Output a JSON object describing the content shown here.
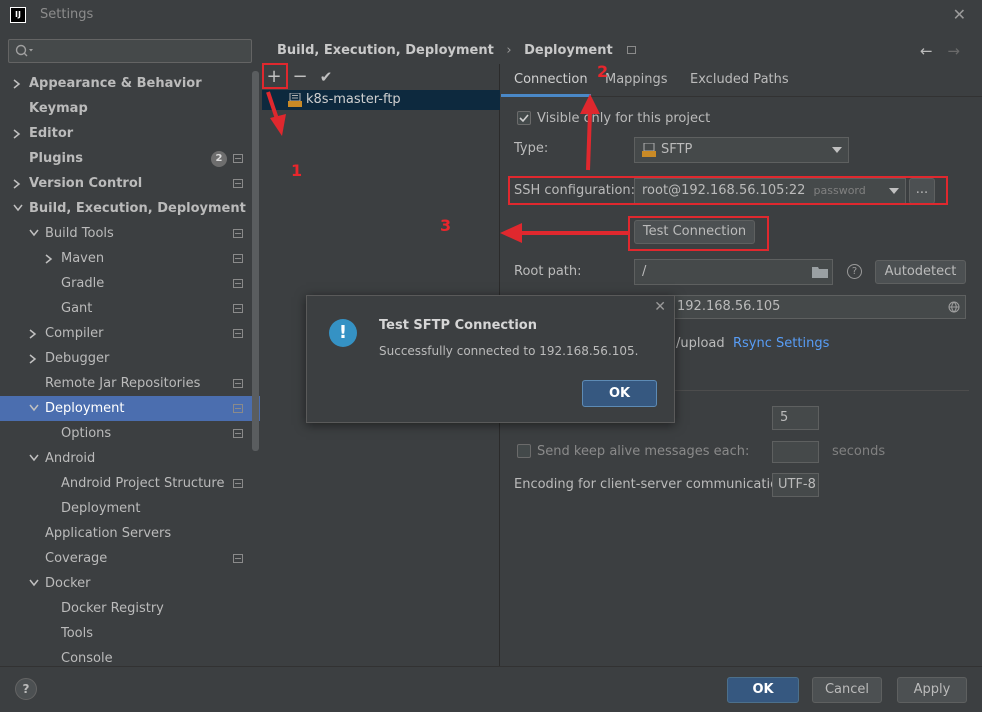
{
  "window": {
    "title": "Settings",
    "app_icon": "IJ"
  },
  "search": {
    "placeholder": ""
  },
  "tree": [
    {
      "label": "Appearance & Behavior",
      "bold": true,
      "arrow": "right"
    },
    {
      "label": "Keymap",
      "bold": true
    },
    {
      "label": "Editor",
      "bold": true,
      "arrow": "right"
    },
    {
      "label": "Plugins",
      "bold": true,
      "badge": "2"
    },
    {
      "label": "Version Control",
      "bold": true,
      "arrow": "right"
    },
    {
      "label": "Build, Execution, Deployment",
      "bold": true,
      "arrow": "down"
    },
    {
      "label": "Build Tools",
      "arrow": "down"
    },
    {
      "label": "Maven",
      "arrow": "right"
    },
    {
      "label": "Gradle"
    },
    {
      "label": "Gant"
    },
    {
      "label": "Compiler",
      "arrow": "right"
    },
    {
      "label": "Debugger",
      "arrow": "right"
    },
    {
      "label": "Remote Jar Repositories"
    },
    {
      "label": "Deployment",
      "arrow": "down",
      "selected": true
    },
    {
      "label": "Options"
    },
    {
      "label": "Android",
      "arrow": "down"
    },
    {
      "label": "Android Project Structure"
    },
    {
      "label": "Deployment"
    },
    {
      "label": "Application Servers"
    },
    {
      "label": "Coverage"
    },
    {
      "label": "Docker",
      "arrow": "down"
    },
    {
      "label": "Docker Registry"
    },
    {
      "label": "Tools"
    },
    {
      "label": "Console"
    }
  ],
  "breadcrumb": {
    "parent": "Build, Execution, Deployment",
    "sep": "›",
    "current": "Deployment"
  },
  "nav": {
    "back": "←",
    "forward": "→"
  },
  "toolbar": {
    "add": "+",
    "remove": "−",
    "apply": "✔"
  },
  "servers": [
    {
      "label": "k8s-master-ftp",
      "icon_text": "SFTP"
    }
  ],
  "tabs": [
    {
      "label": "Connection"
    },
    {
      "label": "Mappings"
    },
    {
      "label": "Excluded Paths"
    }
  ],
  "form": {
    "visible_only_label": "Visible only for this project",
    "type_label": "Type:",
    "type_value": "SFTP",
    "ssh_label": "SSH configuration:",
    "ssh_value": "root@192.168.56.105:22",
    "ssh_hint": "password",
    "ssh_more": "...",
    "test_connection": "Test Connection",
    "root_path_label": "Root path:",
    "root_path_value": "/",
    "help": "?",
    "autodetect": "Autodetect",
    "web_url_value": "192.168.56.105",
    "upload_partial": "/upload",
    "rsync_link": "Rsync Settings",
    "timeout_value": "5",
    "keepalive_label": "Send keep alive messages each:",
    "keepalive_value": "",
    "keepalive_unit": "seconds",
    "encoding_label": "Encoding for client-server communication:",
    "encoding_value": "UTF-8"
  },
  "annotations": {
    "n1": "1",
    "n2": "2",
    "n3": "3"
  },
  "dialog": {
    "title": "Test SFTP Connection",
    "message": "Successfully connected to 192.168.56.105.",
    "ok": "OK",
    "close": "✕",
    "icon": "!"
  },
  "footer": {
    "help": "?",
    "ok": "OK",
    "cancel": "Cancel",
    "apply": "Apply"
  },
  "colors": {
    "background": "#3c3f41",
    "selection": "#4b6eaf",
    "accent": "#4a88c7",
    "primary_button": "#365880",
    "annotation": "#e0282e",
    "link": "#589df6"
  }
}
